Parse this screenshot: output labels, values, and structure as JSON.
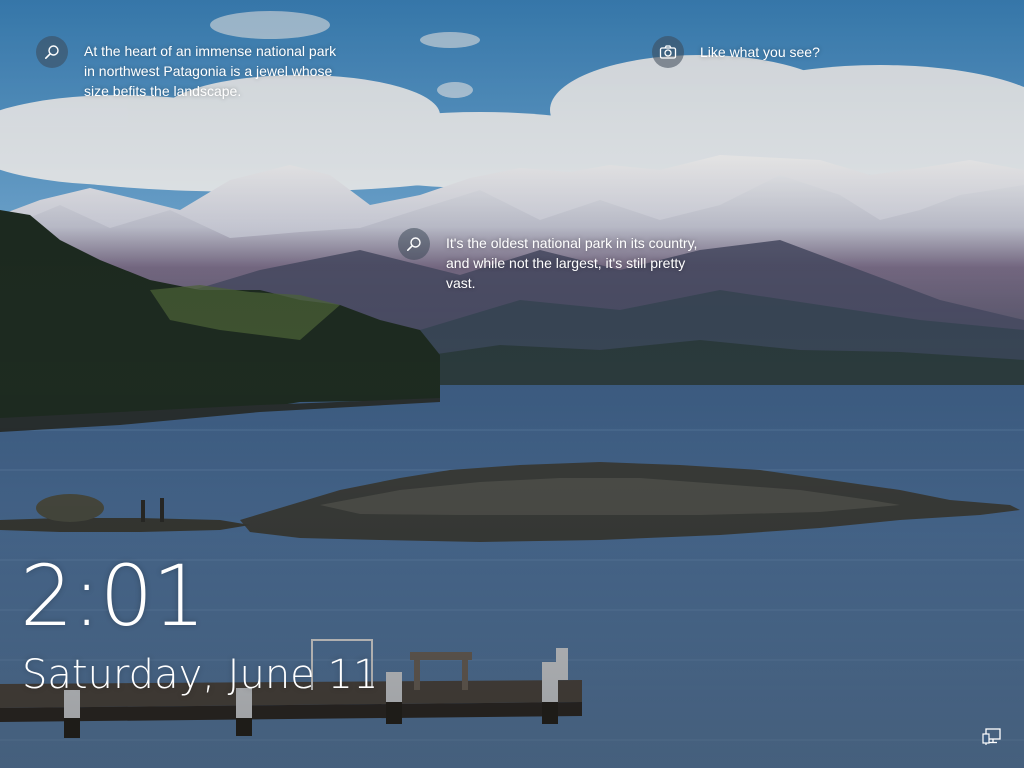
{
  "spotlight": {
    "left": {
      "icon": "search-icon",
      "text": "At the heart of an immense national park\nin northwest Patagonia is a jewel whose\nsize befits the landscape."
    },
    "right": {
      "icon": "camera-icon",
      "text": "Like what you see?"
    },
    "middle": {
      "icon": "search-icon",
      "text": "It's the oldest national park in its country,\nand while not the largest, it's still pretty\nvast."
    }
  },
  "clock": {
    "time": "2:01",
    "date": "Saturday, June 11"
  },
  "status": {
    "network_icon": "network-wired-icon"
  }
}
